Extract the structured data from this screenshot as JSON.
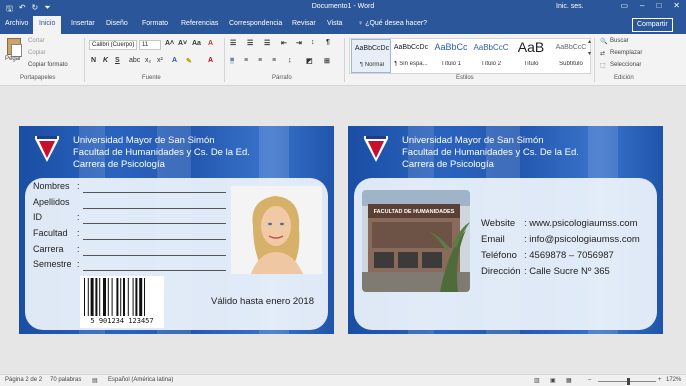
{
  "window": {
    "title": "Documento1 - Word",
    "sign_in": "Inic. ses."
  },
  "tabs": [
    {
      "label": "Archivo"
    },
    {
      "label": "Inicio"
    },
    {
      "label": "Insertar"
    },
    {
      "label": "Diseño"
    },
    {
      "label": "Formato"
    },
    {
      "label": "Referencias"
    },
    {
      "label": "Correspondencia"
    },
    {
      "label": "Revisar"
    },
    {
      "label": "Vista"
    }
  ],
  "tell_me": "♀ ¿Qué desea hacer?",
  "share": "Compartir",
  "ribbon": {
    "clipboard": {
      "paste": "Pegar",
      "cut": "Cortar",
      "copy": "Copiar",
      "format_painter": "Copiar formato",
      "label": "Portapapeles"
    },
    "font": {
      "name": "Calibri (Cuerpo)",
      "size": "11",
      "label": "Fuente"
    },
    "paragraph": {
      "label": "Párrafo"
    },
    "styles": {
      "label": "Estilos",
      "items": [
        {
          "sample": "AaBbCcDc",
          "name": "¶ Normal"
        },
        {
          "sample": "AaBbCcDc",
          "name": "¶ Sin espa..."
        },
        {
          "sample": "AaBbCc",
          "name": "Título 1"
        },
        {
          "sample": "AaBbCcC",
          "name": "Título 2"
        },
        {
          "sample": "AaB",
          "name": "Título"
        },
        {
          "sample": "AaBbCcC",
          "name": "Subtítulo"
        }
      ]
    },
    "editing": {
      "find": "Buscar",
      "replace": "Reemplazar",
      "select": "Seleccionar",
      "label": "Edición"
    }
  },
  "front_card": {
    "header": [
      "Universidad Mayor de San Simón",
      "Facultad de Humanidades y Cs. De la Ed.",
      "Carrera de Psicología"
    ],
    "fields": [
      {
        "label": "Nombres",
        "colon": ":"
      },
      {
        "label": "Apellidos",
        "colon": ""
      },
      {
        "label": "ID",
        "colon": ":"
      },
      {
        "label": "Facultad",
        "colon": ":"
      },
      {
        "label": "Carrera",
        "colon": ":"
      },
      {
        "label": "Semestre",
        "colon": ":"
      }
    ],
    "barcode_number": "5 901234 123457",
    "valid_until": "Válido hasta enero 2018"
  },
  "back_card": {
    "header": [
      "Universidad Mayor de San Simón",
      "Facultad de Humanidades y Cs. De la Ed.",
      "Carrera de Psicología"
    ],
    "building_sign": "FACULTAD DE HUMANIDADES",
    "contact": [
      {
        "label": "Website",
        "value": ": www.psicologiaumss.com"
      },
      {
        "label": "Email",
        "value": ": info@psicologiaumss.com"
      },
      {
        "label": "Teléfono",
        "value": ": 4569878 – 7056987"
      },
      {
        "label": "Dirección",
        "value": ": Calle Sucre Nº 365"
      }
    ]
  },
  "status": {
    "page": "Página 2 de 2",
    "words": "70 palabras",
    "language": "Español (América latina)",
    "zoom": "172%"
  },
  "colors": {
    "accent": "#2b579a",
    "card_blue": "#2458b0"
  }
}
